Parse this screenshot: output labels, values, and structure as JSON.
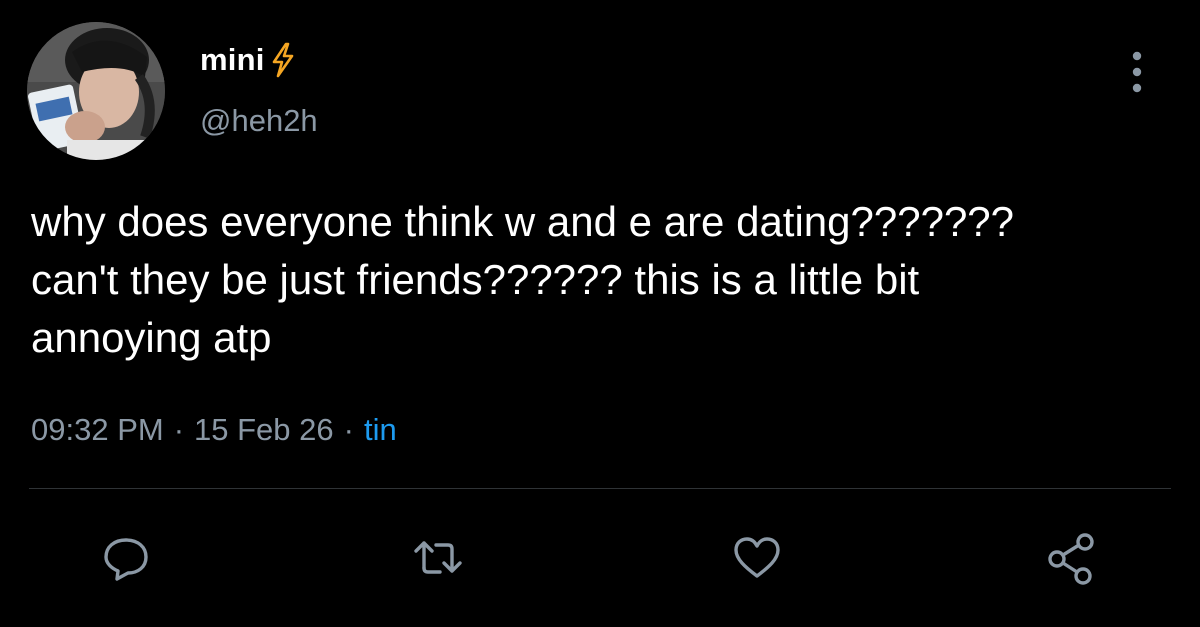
{
  "tweet": {
    "author": {
      "display_name": "mini",
      "handle": "@heh2h",
      "avatar_icon": "profile-photo",
      "badge_icon": "lightning-bolt-icon"
    },
    "text": "why does everyone think w and e are dating???????\ncan't they be just friends?????? this is a little bit\nannoying atp",
    "time": "09:32 PM",
    "date": "15 Feb 26",
    "separator": "·",
    "source": "tin"
  },
  "actions": [
    {
      "name": "reply",
      "icon": "comment-icon"
    },
    {
      "name": "retweet",
      "icon": "retweet-icon"
    },
    {
      "name": "like",
      "icon": "heart-icon"
    },
    {
      "name": "share",
      "icon": "share-icon"
    }
  ],
  "colors": {
    "background": "#000000",
    "text_primary": "#ffffff",
    "text_secondary": "#8b98a5",
    "link": "#1d9bf0",
    "bolt": "#f5a623",
    "divider": "#2f3336"
  }
}
